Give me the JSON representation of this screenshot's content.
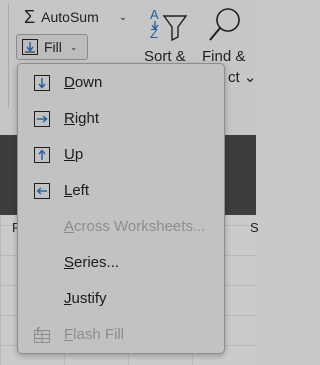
{
  "ribbon": {
    "autosum": {
      "label": "AutoSum",
      "sigma": "Σ",
      "chevron": "⌄"
    },
    "fill": {
      "label": "Fill",
      "chevron": "⌄"
    },
    "sort_filter": {
      "label": "Sort &"
    },
    "find_select": {
      "label": "Find &",
      "label_line2": "ct ⌄"
    }
  },
  "sheet": {
    "column_headers": [
      "P",
      "S"
    ]
  },
  "fill_menu": {
    "items": [
      {
        "id": "down",
        "label": "Down",
        "access_key": "D",
        "rest": "own",
        "enabled": true
      },
      {
        "id": "right",
        "label": "Right",
        "access_key": "R",
        "rest": "ight",
        "enabled": true
      },
      {
        "id": "up",
        "label": "Up",
        "access_key": "U",
        "rest": "p",
        "enabled": true
      },
      {
        "id": "left",
        "label": "Left",
        "access_key": "L",
        "rest": "eft",
        "enabled": true
      },
      {
        "id": "across",
        "label": "Across Worksheets...",
        "access_key": "A",
        "rest": "cross Worksheets...",
        "enabled": false
      },
      {
        "id": "series",
        "label": "Series...",
        "access_key": "S",
        "rest": "eries...",
        "enabled": true
      },
      {
        "id": "justify",
        "label": "Justify",
        "access_key": "J",
        "rest": "ustify",
        "enabled": true
      },
      {
        "id": "flashfill",
        "label": "Flash Fill",
        "access_key": "F",
        "rest": "lash Fill",
        "enabled": false
      }
    ]
  }
}
